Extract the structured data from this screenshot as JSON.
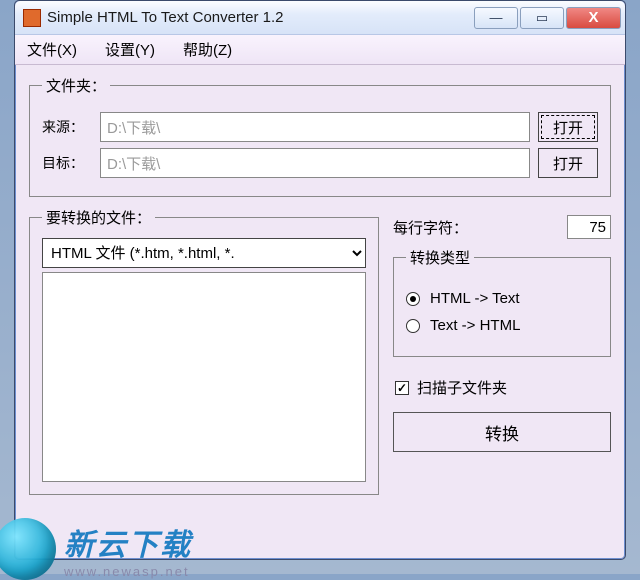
{
  "title": "Simple HTML To Text Converter 1.2",
  "menu": {
    "file": "文件(X)",
    "settings": "设置(Y)",
    "help": "帮助(Z)"
  },
  "folders": {
    "legend": "文件夹：",
    "source_label": "来源：",
    "source_path": "D:\\下载\\",
    "target_label": "目标：",
    "target_path": "D:\\下载\\",
    "open": "打开"
  },
  "files": {
    "legend": "要转换的文件：",
    "filter": "HTML 文件 (*.htm, *.html, *."
  },
  "chars": {
    "label": "每行字符：",
    "value": "75"
  },
  "type": {
    "legend": "转换类型",
    "opt1": "HTML -> Text",
    "opt2": "Text -> HTML"
  },
  "scan": {
    "label": "扫描子文件夹"
  },
  "convert": "转换",
  "watermark": {
    "main": "新云下载",
    "url": "www.newasp.net"
  }
}
